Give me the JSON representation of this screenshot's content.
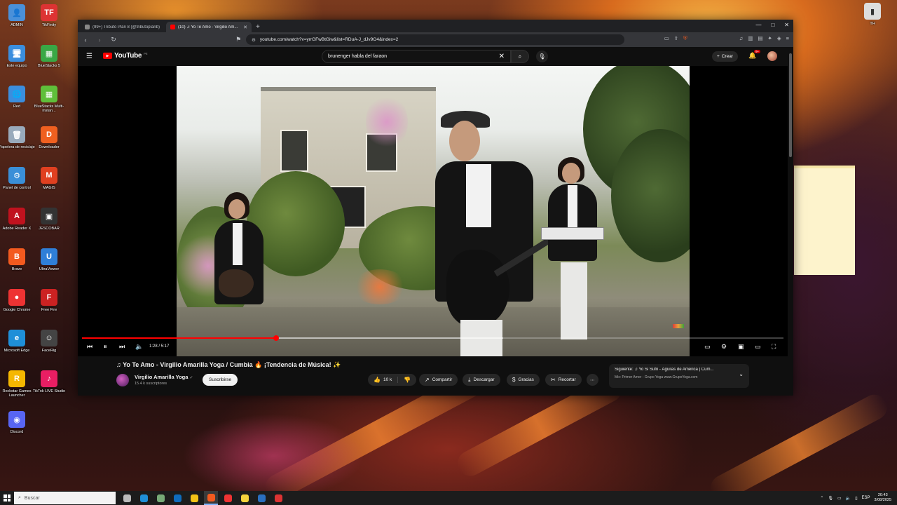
{
  "desktop": {
    "icons_left": [
      {
        "label": "ADMIN",
        "color": "#4a90d9",
        "glyph": "👤"
      },
      {
        "label": "TikFinity",
        "color": "#d33",
        "glyph": "TF"
      },
      {
        "label": "Este equipo",
        "color": "#3b8ede",
        "glyph": "🖥"
      },
      {
        "label": "BlueStacks 5",
        "color": "#39a845",
        "glyph": "▦"
      },
      {
        "label": "Red",
        "color": "#3b8ede",
        "glyph": "🌐"
      },
      {
        "label": "BlueStacks Multi-instan...",
        "color": "#5fbf3a",
        "glyph": "▦"
      },
      {
        "label": "Papelera de reciclaje",
        "color": "#9ab",
        "glyph": "🗑"
      },
      {
        "label": "Downloader",
        "color": "#f06020",
        "glyph": "D"
      },
      {
        "label": "Panel de control",
        "color": "#3a8fd8",
        "glyph": "⚙"
      },
      {
        "label": "MAGIS",
        "color": "#e04020",
        "glyph": "M"
      },
      {
        "label": "Adobe Reader X",
        "color": "#c0121e",
        "glyph": "A"
      },
      {
        "label": "JESCOBAR",
        "color": "#333",
        "glyph": "▣"
      },
      {
        "label": "Brave",
        "color": "#f35a1f",
        "glyph": "B"
      },
      {
        "label": "UltraViewer",
        "color": "#2f7fd8",
        "glyph": "U"
      },
      {
        "label": "Google Chrome",
        "color": "#e33",
        "glyph": "●"
      },
      {
        "label": "Free Fire",
        "color": "#c22",
        "glyph": "F"
      },
      {
        "label": "Microsoft Edge",
        "color": "#1f8fd8",
        "glyph": "e"
      },
      {
        "label": "FaceRig",
        "color": "#444",
        "glyph": "☺"
      },
      {
        "label": "Rockstar Games Launcher",
        "color": "#f5b700",
        "glyph": "R"
      },
      {
        "label": "TikTok LIVE Studio",
        "color": "#e91e63",
        "glyph": "♪"
      },
      {
        "label": "Discord",
        "color": "#5865f2",
        "glyph": "◉"
      }
    ],
    "icon_right": {
      "label": "TH",
      "color": "#ddd",
      "glyph": "▮"
    }
  },
  "browser": {
    "tabs": [
      {
        "title": "(99+) Tributo Plan 8 (@tributoplanb)",
        "active": false,
        "fav_color": "#888"
      },
      {
        "title": "(10) ♫ Yo Te Amo - Virgilio Am...",
        "active": true,
        "fav_color": "#ff0000"
      }
    ],
    "new_tab": "+",
    "window_controls": [
      "—",
      "□",
      "✕"
    ],
    "url": "youtube.com/watch?v=yrrGFwBtGiw&list=RDuA-J_dJv9O4&index=2",
    "tab_close": "✕"
  },
  "youtube": {
    "logo_text": "YouTube",
    "country_code": "PE",
    "search_query": "brunenger habla del faraon",
    "create_label": "Crear",
    "notif_count": "9+",
    "player": {
      "current_time": "1:28",
      "duration": "5:17",
      "time_label": "1:28 / 5:17",
      "progress_fraction": 0.277,
      "buffer_fraction": 0.6
    },
    "video": {
      "title": "♫ Yo Te Amo - Virgilio Amarilla Yoga / Cumbia 🔥 ¡Tendencia de Música! ✨",
      "channel": "Virgilio Amarilla Yoga",
      "verified": "✓",
      "subscribers": "15.4 k suscriptores",
      "subscribe_label": "Suscribirse",
      "likes": "10 k",
      "share_label": "Compartir",
      "download_label": "Descargar",
      "thanks_label": "Gracias",
      "clip_label": "Recortar",
      "more_label": "⋯"
    },
    "up_next": {
      "line1": "Siguiente: ♫ Yo Si Sufri - Águilas de América | Cum...",
      "line2": "Mix: Primer Amor - Grupo Yoga www.GrupoYoga.com"
    }
  },
  "taskbar": {
    "search_placeholder": "Buscar",
    "apps": [
      {
        "name": "task-view",
        "color": "#bbb",
        "active": false
      },
      {
        "name": "edge",
        "color": "#1f8fd8",
        "active": false
      },
      {
        "name": "copilot",
        "color": "#7a7",
        "active": false
      },
      {
        "name": "outlook",
        "color": "#0f6cbd",
        "active": false
      },
      {
        "name": "explorer",
        "color": "#f3c316",
        "active": false
      },
      {
        "name": "brave",
        "color": "#f35a1f",
        "active": true
      },
      {
        "name": "chrome",
        "color": "#e33",
        "active": false
      },
      {
        "name": "sticky-notes",
        "color": "#f5d33c",
        "active": false
      },
      {
        "name": "steam",
        "color": "#2a6fbf",
        "active": false
      },
      {
        "name": "ultraviewer",
        "color": "#d33",
        "active": false
      }
    ],
    "language": "ESP",
    "time": "20:43",
    "date": "3/08/2025"
  }
}
